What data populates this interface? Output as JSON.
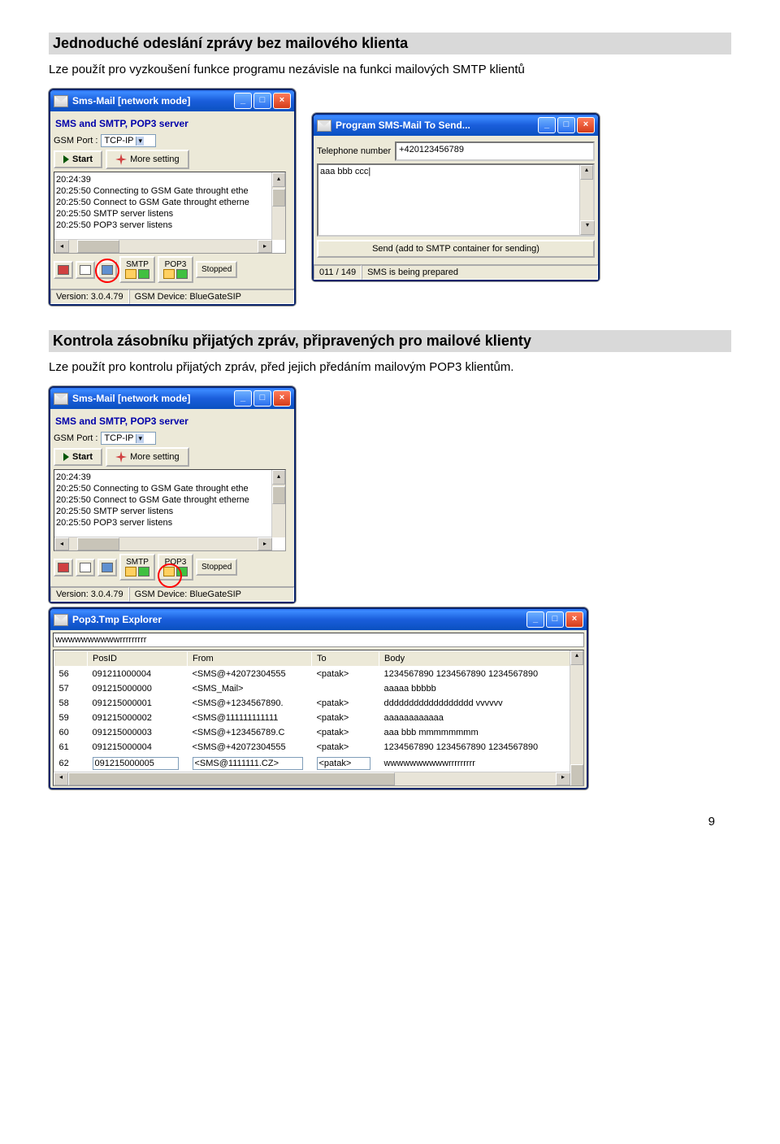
{
  "sections": {
    "s1": {
      "title": "Jednoduché odeslání zprávy bez mailového klienta",
      "desc": "Lze použít pro vyzkoušení funkce programu nezávisle na funkci mailových SMTP klientů"
    },
    "s2": {
      "title": "Kontrola zásobníku přijatých zpráv, připravených pro mailové klienty",
      "desc": "Lze použít pro kontrolu přijatých zpráv, před jejich předáním mailovým POP3 klientům."
    }
  },
  "main_window": {
    "title": "Sms-Mail  [network mode]",
    "panel_title": "SMS and SMTP, POP3 server",
    "gsm_port_label": "GSM Port :",
    "gsm_port_value": "TCP-IP",
    "start_btn": "Start",
    "more_btn": "More setting",
    "log_lines": [
      "20:24:39",
      "20:25:50   Connecting to GSM Gate throught ethe",
      "20:25:50   Connect to GSM Gate throught etherne",
      "20:25:50   SMTP server listens",
      "20:25:50   POP3 server listens"
    ],
    "tabs": {
      "smtp": "SMTP",
      "pop3": "POP3",
      "stopped": "Stopped"
    },
    "status": {
      "version": "Version: 3.0.4.79",
      "device": "GSM Device: BlueGateSIP"
    }
  },
  "send_window": {
    "title": "Program SMS-Mail To Send...",
    "tel_label": "Telephone number",
    "tel_value": "+420123456789",
    "message": "aaa bbb ccc",
    "send_btn": "Send   (add to SMTP container for sending)",
    "status_left": "011 / 149",
    "status_right": "SMS is being prepared"
  },
  "pop_explorer": {
    "title": "Pop3.Tmp  Explorer",
    "top_line": "wwwwwwwwwwrrrrrrrrr",
    "columns": [
      "",
      "PosID",
      "From",
      "To",
      "Body"
    ],
    "rows": [
      {
        "n": "56",
        "pos": "091211000004",
        "from": "<SMS@+42072304555",
        "to": "<patak>",
        "body": "1234567890 1234567890 1234567890"
      },
      {
        "n": "57",
        "pos": "091215000000",
        "from": "<SMS_Mail>",
        "to": "",
        "body": "aaaaa bbbbb"
      },
      {
        "n": "58",
        "pos": "091215000001",
        "from": "<SMS@+1234567890.",
        "to": "<patak>",
        "body": "dddddddddddddddddd  vvvvvv"
      },
      {
        "n": "59",
        "pos": "091215000002",
        "from": "<SMS@111111111111",
        "to": "<patak>",
        "body": "aaaaaaaaaaaa"
      },
      {
        "n": "60",
        "pos": "091215000003",
        "from": "<SMS@+123456789.C",
        "to": "<patak>",
        "body": "aaa bbb mmmmmmmm"
      },
      {
        "n": "61",
        "pos": "091215000004",
        "from": "<SMS@+42072304555",
        "to": "<patak>",
        "body": "1234567890 1234567890 1234567890"
      },
      {
        "n": "62",
        "pos": "091215000005",
        "from": "<SMS@1111111.CZ>",
        "to": "<patak>",
        "body": "wwwwwwwwwwrrrrrrrrr"
      }
    ]
  },
  "page_number": "9"
}
